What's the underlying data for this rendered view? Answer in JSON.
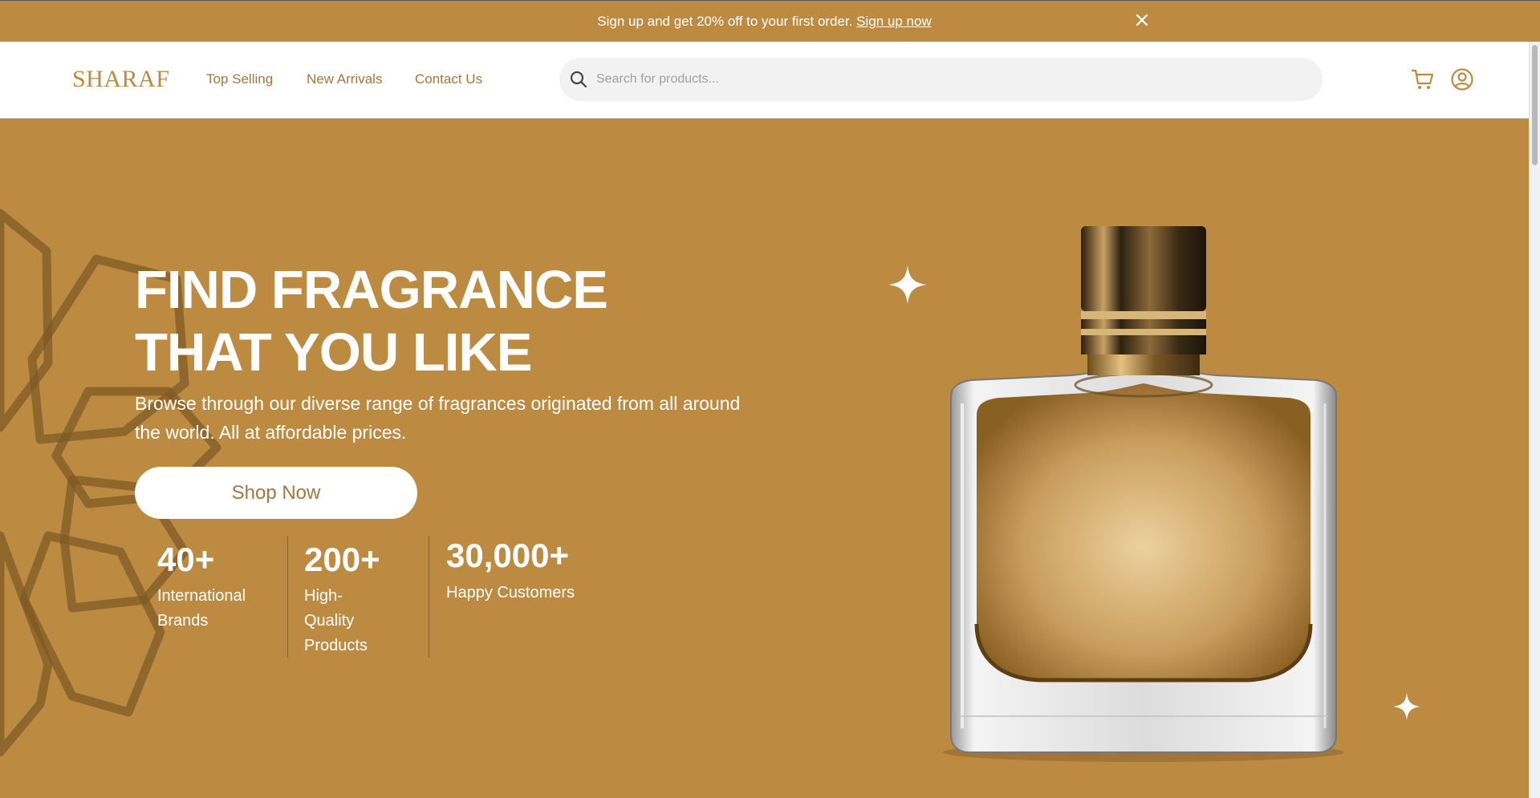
{
  "promo": {
    "text": "Sign up and get 20% off to your first order.",
    "link": "Sign up now"
  },
  "header": {
    "logo": "SHARAF",
    "nav": [
      "Top Selling",
      "New Arrivals",
      "Contact Us"
    ],
    "search_placeholder": "Search for products..."
  },
  "hero": {
    "headline_line1": "FIND FRAGRANCE",
    "headline_line2": "THAT YOU LIKE",
    "subtext": "Browse through our diverse range of fragrances originated from all around the world. All at affordable prices.",
    "cta": "Shop Now",
    "stats": [
      {
        "value": "40+",
        "label_lines": [
          "International",
          "Brands"
        ]
      },
      {
        "value": "200+",
        "label_lines": [
          "High-",
          "Quality",
          "Products"
        ]
      },
      {
        "value": "30,000+",
        "label_lines": [
          "Happy Customers"
        ]
      }
    ]
  },
  "colors": {
    "brand": "#bd8a42",
    "brand_text": "#a37740",
    "header_bg": "#ffffff",
    "search_bg": "#f2f2f2"
  },
  "icons": [
    "close-icon",
    "search-icon",
    "cart-icon",
    "user-account-icon",
    "sparkle-icon"
  ]
}
